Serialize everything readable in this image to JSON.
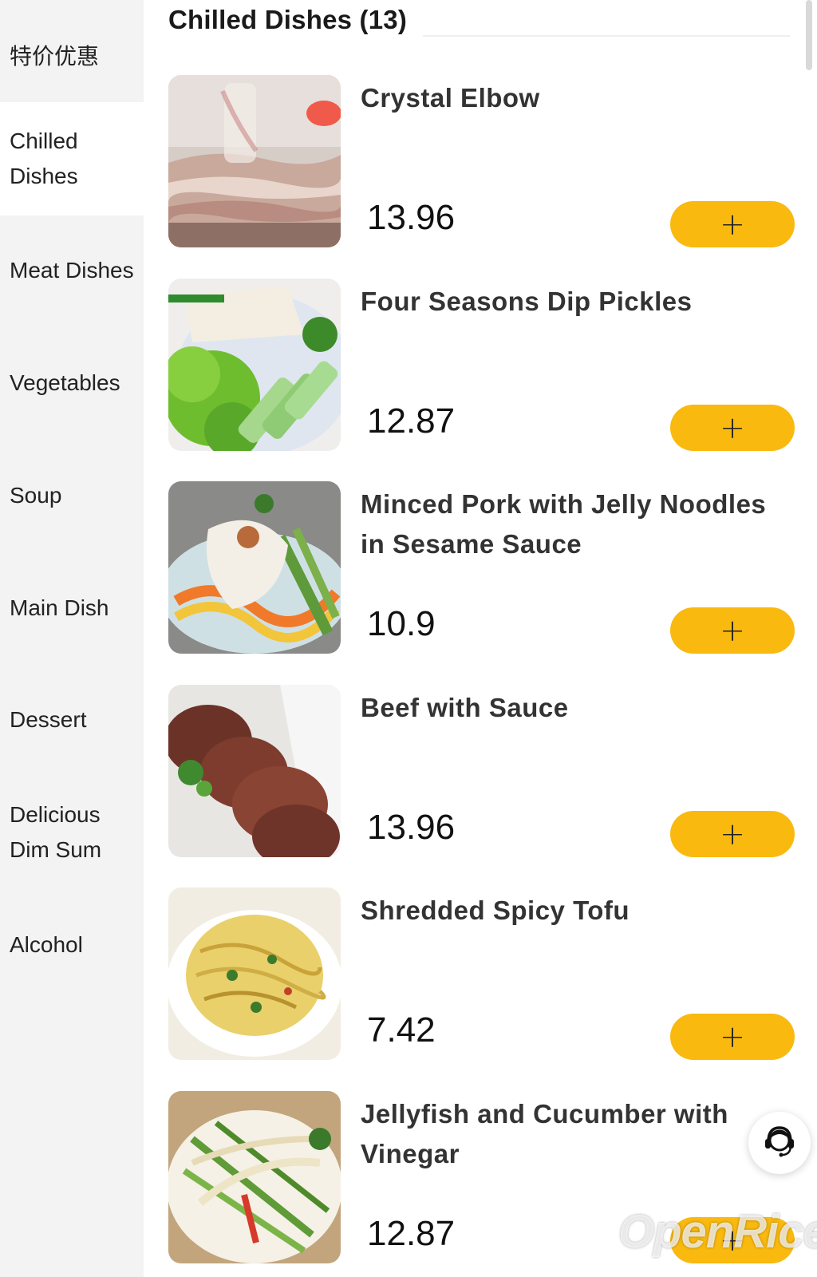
{
  "sidebar": {
    "categories": [
      {
        "label": "特价优惠"
      },
      {
        "label": "Chilled Dishes"
      },
      {
        "label": "Meat Dishes"
      },
      {
        "label": "Vegetables"
      },
      {
        "label": "Soup"
      },
      {
        "label": "Main Dish"
      },
      {
        "label": "Dessert"
      },
      {
        "label": "Delicious Dim Sum"
      },
      {
        "label": "Alcohol"
      }
    ],
    "active_index": 1
  },
  "section": {
    "title": "Chilled Dishes (13)"
  },
  "dishes": [
    {
      "name": "Crystal Elbow",
      "price": "13.96",
      "add_label": "+"
    },
    {
      "name": "Four Seasons Dip Pickles",
      "price": "12.87",
      "add_label": "+"
    },
    {
      "name": "Minced Pork with Jelly Noodles in Sesame Sauce",
      "price": "10.9",
      "add_label": "+"
    },
    {
      "name": "Beef with Sauce",
      "price": "13.96",
      "add_label": "+"
    },
    {
      "name": "Shredded Spicy Tofu",
      "price": "7.42",
      "add_label": "+"
    },
    {
      "name": "Jellyfish and Cucumber with Vinegar",
      "price": "12.87",
      "add_label": "+"
    }
  ],
  "support": {
    "icon": "customer-service-icon"
  },
  "watermark": {
    "text": "OpenRice"
  },
  "colors": {
    "accent": "#f9b90f",
    "sidebar_bg": "#f3f3f3",
    "active_bg": "#ffffff"
  }
}
